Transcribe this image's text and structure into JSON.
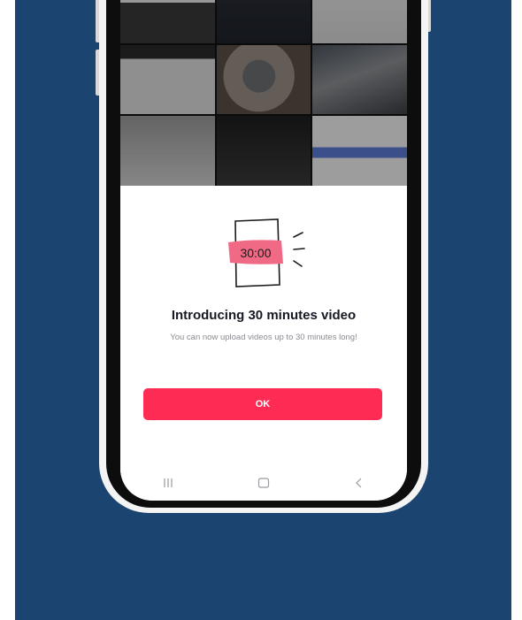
{
  "dialog": {
    "title": "Introducing 30 minutes video",
    "description": "You can now upload videos up to 30 minutes long!",
    "ok_label": "OK"
  },
  "illustration": {
    "time_label": "30:00",
    "icon": "video-length-icon"
  },
  "android_nav": {
    "recents_icon": "recents-icon",
    "home_icon": "home-icon",
    "back_icon": "back-icon"
  },
  "colors": {
    "primary": "#fe2c55",
    "backdrop": "#1b4470",
    "highlight": "#f06a86",
    "title": "#161823",
    "subtitle": "#8a8b91"
  }
}
